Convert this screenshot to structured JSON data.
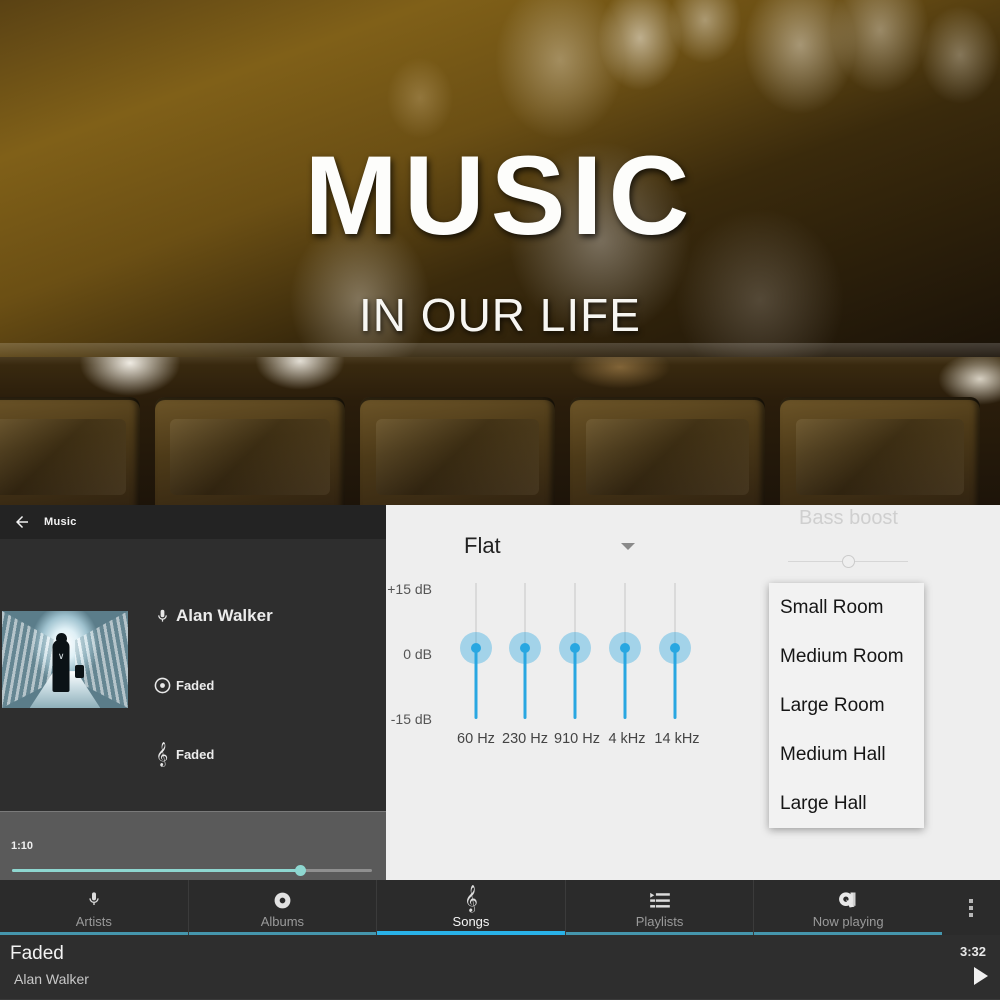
{
  "banner": {
    "title": "MUSIC",
    "subtitle": "IN OUR LIFE"
  },
  "left_panel": {
    "appbar": {
      "title": "Music",
      "back_icon": "back-arrow-icon"
    },
    "album_art_alt": "Faded album cover",
    "meta": [
      {
        "icon": "microphone-icon",
        "text": "Alan Walker"
      },
      {
        "icon": "album-disc-icon",
        "text": "Faded"
      },
      {
        "icon": "treble-clef-icon",
        "text": "Faded"
      }
    ],
    "seek": {
      "current_time": "1:10",
      "progress_percent": 80
    }
  },
  "equalizer": {
    "preset": "Flat",
    "preset_caret_icon": "chevron-down-icon",
    "db_labels": [
      "+15 dB",
      "0 dB",
      "-15 dB"
    ],
    "bands": [
      {
        "freq": "60 Hz",
        "gain_db": 0
      },
      {
        "freq": "230 Hz",
        "gain_db": 0
      },
      {
        "freq": "910 Hz",
        "gain_db": 0
      },
      {
        "freq": "4 kHz",
        "gain_db": 0
      },
      {
        "freq": "14 kHz",
        "gain_db": 0
      }
    ],
    "bass_boost": {
      "label": "Bass boost",
      "value_percent": 50
    },
    "accent_color": "#29a7e1",
    "dropdown": {
      "open": true,
      "options": [
        "Small Room",
        "Medium Room",
        "Large Room",
        "Medium Hall",
        "Large Hall"
      ]
    }
  },
  "tabs": {
    "active": "Songs",
    "items": [
      {
        "label": "Artists",
        "icon": "microphone-icon"
      },
      {
        "label": "Albums",
        "icon": "album-disc-icon"
      },
      {
        "label": "Songs",
        "icon": "treble-clef-icon"
      },
      {
        "label": "Playlists",
        "icon": "playlist-icon"
      },
      {
        "label": "Now playing",
        "icon": "now-playing-icon"
      }
    ],
    "overflow_icon": "more-vertical-icon",
    "indicator_color": "#29b2e8"
  },
  "now_playing": {
    "title": "Faded",
    "artist": "Alan Walker",
    "duration": "3:32",
    "play_icon": "play-icon"
  }
}
